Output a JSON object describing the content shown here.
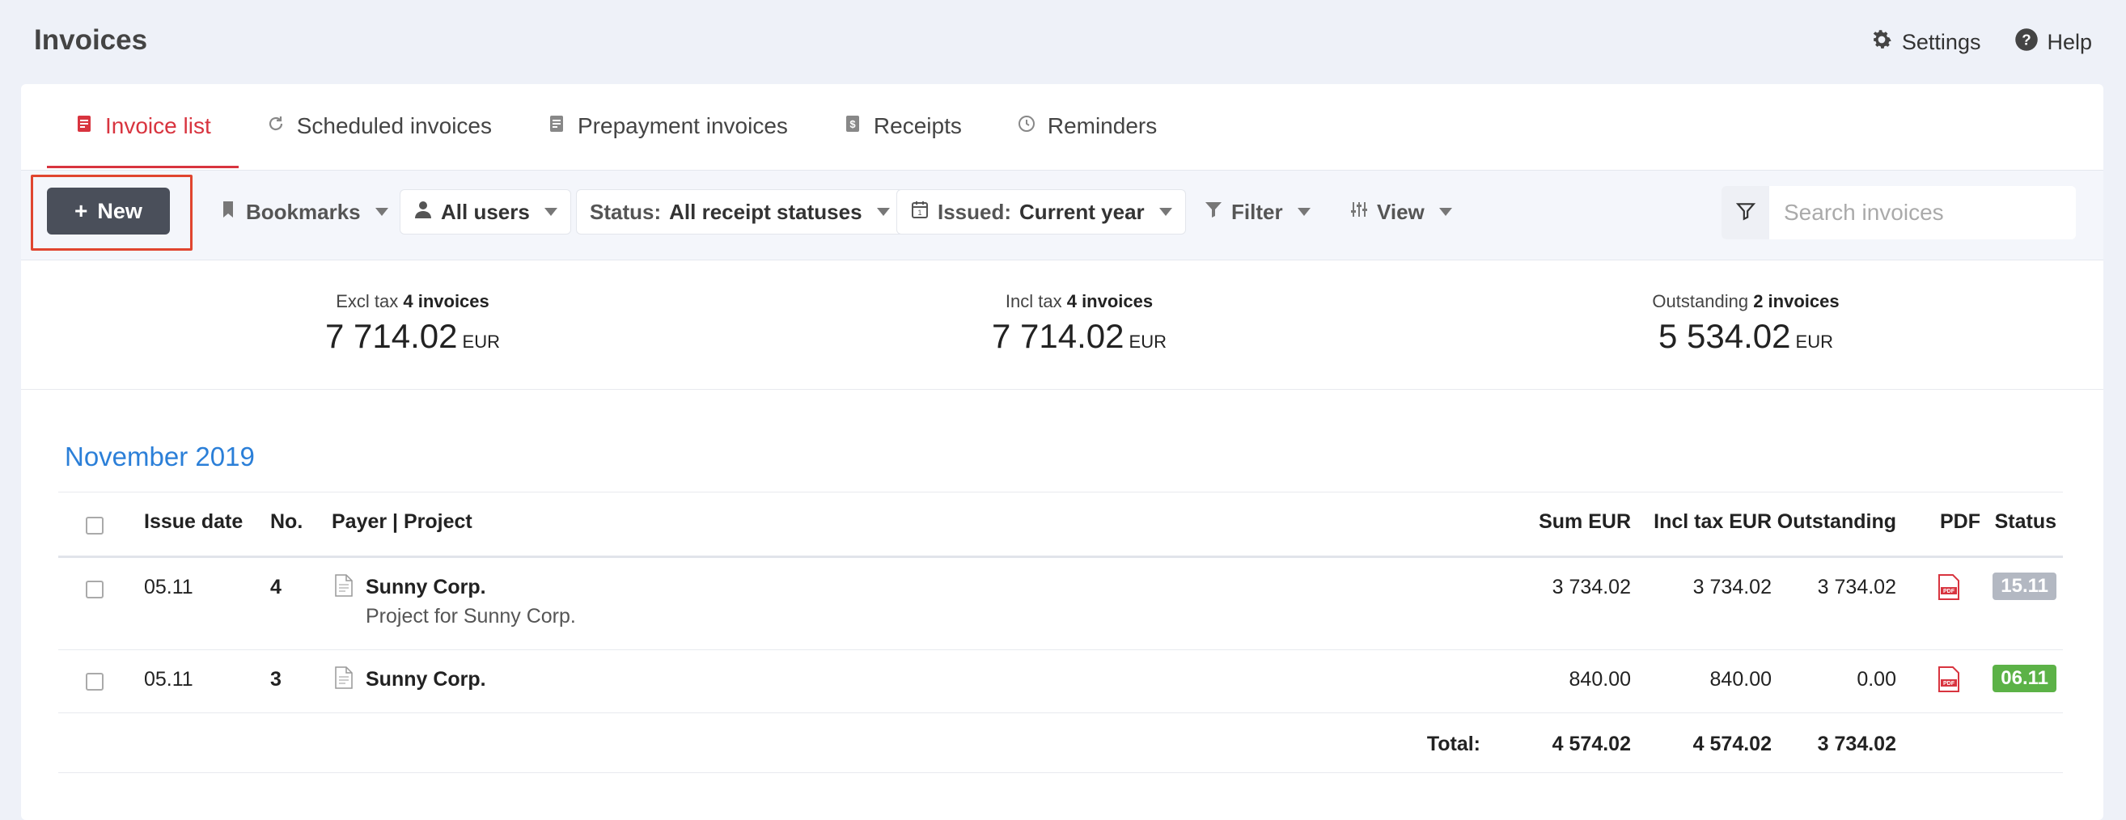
{
  "app": {
    "title": "Invoices"
  },
  "top_links": {
    "settings": "Settings",
    "help": "Help"
  },
  "tabs": [
    {
      "label": "Invoice list",
      "icon": "invoice-icon",
      "active": true
    },
    {
      "label": "Scheduled invoices",
      "icon": "refresh-icon"
    },
    {
      "label": "Prepayment invoices",
      "icon": "receipt-icon"
    },
    {
      "label": "Receipts",
      "icon": "dollar-receipt-icon"
    },
    {
      "label": "Reminders",
      "icon": "clock-icon"
    }
  ],
  "toolbar": {
    "new_label": "New",
    "bookmarks_label": "Bookmarks",
    "users_label": "All users",
    "status_prefix": "Status:",
    "status_value": "All receipt statuses",
    "issued_prefix": "Issued:",
    "issued_value": "Current year",
    "filter_label": "Filter",
    "view_label": "View",
    "search_placeholder": "Search invoices"
  },
  "summary": {
    "excl": {
      "label": "Excl tax",
      "count": "4 invoices",
      "value": "7 714.02",
      "currency": "EUR"
    },
    "incl": {
      "label": "Incl tax",
      "count": "4 invoices",
      "value": "7 714.02",
      "currency": "EUR"
    },
    "outstanding": {
      "label": "Outstanding",
      "count": "2 invoices",
      "value": "5 534.02",
      "currency": "EUR"
    }
  },
  "month": "November 2019",
  "table": {
    "headers": {
      "issue_date": "Issue date",
      "no": "No.",
      "payer": "Payer | Project",
      "sum": "Sum EUR",
      "incl": "Incl tax EUR",
      "outstanding": "Outstanding",
      "pdf": "PDF",
      "status": "Status"
    },
    "rows": [
      {
        "date": "05.11",
        "no": "4",
        "payer": "Sunny Corp.",
        "project": "Project for Sunny Corp.",
        "sum": "3 734.02",
        "incl": "3 734.02",
        "outstanding": "3 734.02",
        "status": "15.11",
        "status_color": "#b3b8c2"
      },
      {
        "date": "05.11",
        "no": "3",
        "payer": "Sunny Corp.",
        "project": "",
        "sum": "840.00",
        "incl": "840.00",
        "outstanding": "0.00",
        "status": "06.11",
        "status_color": "#5cb247"
      }
    ],
    "total": {
      "label": "Total:",
      "sum": "4 574.02",
      "incl": "4 574.02",
      "outstanding": "3 734.02"
    }
  },
  "colors": {
    "accent": "#d8343f",
    "link": "#2b7fd8",
    "highlight": "#e0452f"
  }
}
